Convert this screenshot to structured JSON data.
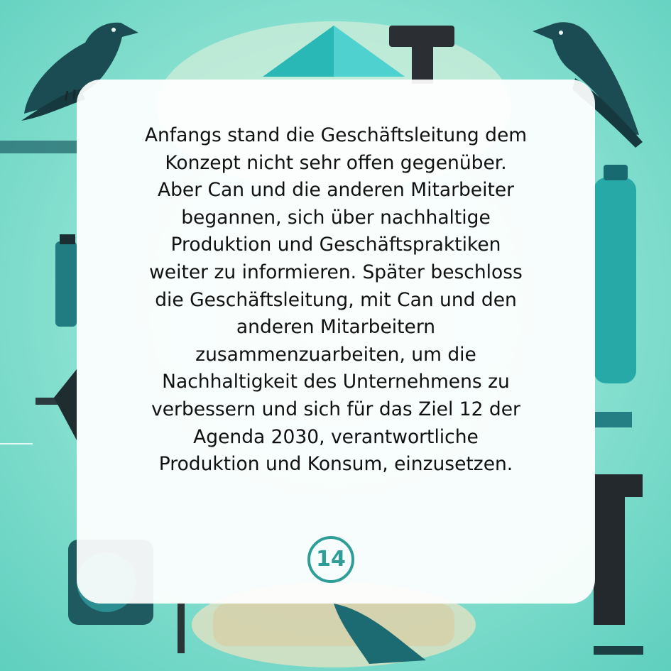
{
  "story": {
    "lines": [
      "Anfangs stand die Geschäftsleitung dem",
      "Konzept nicht sehr offen gegenüber.",
      "Aber Can und die anderen Mitarbeiter",
      "begannen, sich über nachhaltige",
      "Produktion und Geschäftspraktiken",
      "weiter zu informieren. Später beschloss",
      "die Geschäftsleitung, mit Can und den",
      "anderen Mitarbeitern",
      "zusammenzuarbeiten, um die",
      "Nachhaltigkeit des Unternehmens zu",
      "verbessern und sich für das Ziel 12 der",
      "Agenda 2030, verantwortliche",
      "Produktion und Konsum, einzusetzen."
    ]
  },
  "page_number": "14",
  "colors": {
    "background": "#8fe3d3",
    "accent_teal": "#2f9e98",
    "dark_teal": "#1f4f55",
    "bird": "#1c4c53",
    "text": "#111111"
  },
  "icons": [
    "crow-left-icon",
    "crow-right-icon",
    "teal-bottle-icon",
    "letter-t-shape-icon",
    "triangle-shape-icon"
  ]
}
